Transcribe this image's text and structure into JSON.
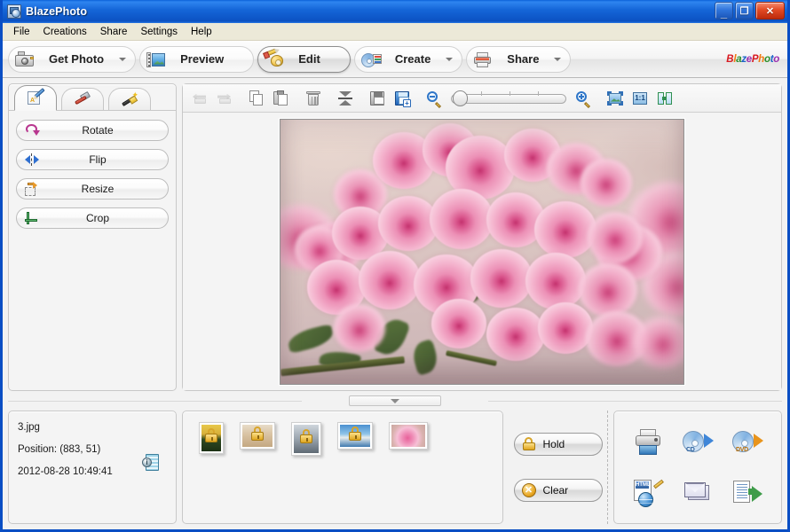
{
  "window": {
    "title": "BlazePhoto",
    "app_icon": "photo-app-icon",
    "buttons": {
      "minimize": "_",
      "maximize": "□",
      "close": "✕"
    }
  },
  "menubar": {
    "items": [
      {
        "label": "File"
      },
      {
        "label": "Creations"
      },
      {
        "label": "Share"
      },
      {
        "label": "Settings"
      },
      {
        "label": "Help"
      }
    ]
  },
  "main_toolbar": {
    "buttons": [
      {
        "label": "Get Photo",
        "icon": "camera-icon",
        "has_dropdown": true,
        "active": false
      },
      {
        "label": "Preview",
        "icon": "filmstrip-photo-icon",
        "has_dropdown": false,
        "active": false
      },
      {
        "label": "Edit",
        "icon": "pencil-palette-icon",
        "has_dropdown": false,
        "active": true
      },
      {
        "label": "Create",
        "icon": "cd-card-icon",
        "has_dropdown": true,
        "active": false
      },
      {
        "label": "Share",
        "icon": "printer-icon",
        "has_dropdown": true,
        "active": false
      }
    ],
    "logo": "BlazePhoto"
  },
  "tools_panel": {
    "tabs": [
      {
        "icon": "pencil-paper-icon",
        "name": "edit-tab",
        "active": true
      },
      {
        "icon": "hammer-icon",
        "name": "enhance-tab",
        "active": false
      },
      {
        "icon": "magic-wand-icon",
        "name": "effects-tab",
        "active": false
      }
    ],
    "buttons": [
      {
        "label": "Rotate",
        "icon": "rotate-icon"
      },
      {
        "label": "Flip",
        "icon": "flip-icon"
      },
      {
        "label": "Resize",
        "icon": "resize-icon"
      },
      {
        "label": "Crop",
        "icon": "crop-icon"
      }
    ]
  },
  "editor_toolbar": {
    "items": [
      {
        "name": "undo-button",
        "icon": "undo-icon",
        "disabled": true
      },
      {
        "name": "redo-button",
        "icon": "redo-icon",
        "disabled": true
      },
      {
        "name": "copy-button",
        "icon": "copy-icon",
        "disabled": false
      },
      {
        "name": "paste-button",
        "icon": "paste-icon",
        "disabled": false
      },
      {
        "name": "delete-button",
        "icon": "trash-icon",
        "disabled": false
      },
      {
        "name": "flatten-button",
        "icon": "flatten-icon",
        "disabled": false
      },
      {
        "name": "save-button",
        "icon": "save-icon",
        "disabled": false
      },
      {
        "name": "save-as-button",
        "icon": "save-as-icon",
        "disabled": false
      }
    ],
    "zoom_out": "zoom-out-icon",
    "zoom_in": "zoom-in-icon",
    "fit_to_window": "fit-to-window-icon",
    "actual_size": "actual-size-icon",
    "actual_size_label": "1:1",
    "compare": "compare-icon",
    "slider_value": 4
  },
  "canvas": {
    "photo_alt": "pink azalea blossoms close-up"
  },
  "splitter": {
    "icon": "chevron-down-icon"
  },
  "info_panel": {
    "filename": "3.jpg",
    "position": "Position: (883, 51)",
    "timestamp": "2012-08-28 10:49:41",
    "info_icon": "image-properties-icon"
  },
  "thumbnails": [
    {
      "name": "thumbnail-1",
      "class": "t1",
      "locked": true
    },
    {
      "name": "thumbnail-2",
      "class": "t2",
      "locked": true
    },
    {
      "name": "thumbnail-3",
      "class": "t3",
      "locked": true
    },
    {
      "name": "thumbnail-4",
      "class": "t4",
      "locked": true
    },
    {
      "name": "thumbnail-5",
      "class": "t5",
      "locked": false
    }
  ],
  "hold_panel": {
    "hold_label": "Hold",
    "hold_icon": "lock-icon",
    "clear_label": "Clear",
    "clear_icon": "clear-x-icon"
  },
  "actions": [
    {
      "name": "print-action",
      "icon": "printer-icon"
    },
    {
      "name": "burn-cd-action",
      "icon": "cd-burn-icon",
      "label": "CD"
    },
    {
      "name": "burn-dvd-action",
      "icon": "dvd-burn-icon",
      "label": "DVD"
    },
    {
      "name": "web-gallery-action",
      "icon": "html-globe-icon",
      "label": "HTML"
    },
    {
      "name": "email-action",
      "icon": "email-icon"
    },
    {
      "name": "export-action",
      "icon": "export-icon"
    }
  ],
  "colors": {
    "titlebar_blue": "#1566d8",
    "menubar": "#ece9d8",
    "body_bg": "#f2f2f2",
    "panel_bg": "#f4f4f4",
    "close_red": "#e24a24"
  }
}
